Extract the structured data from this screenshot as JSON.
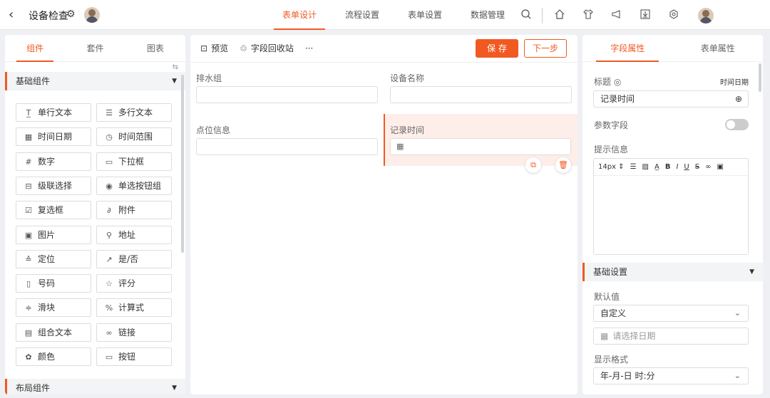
{
  "header": {
    "title": "设备检查",
    "tabs": [
      {
        "label": "表单设计",
        "active": true
      },
      {
        "label": "流程设置",
        "active": false
      },
      {
        "label": "表单设置",
        "active": false
      },
      {
        "label": "数据管理",
        "active": false
      }
    ],
    "icons": [
      "search-icon",
      "home-icon",
      "shirt-icon",
      "megaphone-icon",
      "download-icon",
      "settings-icon"
    ],
    "accent": "#f05a22"
  },
  "left": {
    "tabs": [
      "组件",
      "套件",
      "图表"
    ],
    "section_basic": "基础组件",
    "section_layout": "布局组件",
    "components": [
      {
        "label": "单行文本",
        "icon": "T̲"
      },
      {
        "label": "多行文本",
        "icon": "☰"
      },
      {
        "label": "时间日期",
        "icon": "▦"
      },
      {
        "label": "时间范围",
        "icon": "◷"
      },
      {
        "label": "数字",
        "icon": "#"
      },
      {
        "label": "下拉框",
        "icon": "▭"
      },
      {
        "label": "级联选择",
        "icon": "⊟"
      },
      {
        "label": "单选按钮组",
        "icon": "◉"
      },
      {
        "label": "复选框",
        "icon": "☑"
      },
      {
        "label": "附件",
        "icon": "∂"
      },
      {
        "label": "图片",
        "icon": "▣"
      },
      {
        "label": "地址",
        "icon": "⚲"
      },
      {
        "label": "定位",
        "icon": "≙"
      },
      {
        "label": "是/否",
        "icon": "↗"
      },
      {
        "label": "号码",
        "icon": "▯"
      },
      {
        "label": "评分",
        "icon": "☆"
      },
      {
        "label": "滑块",
        "icon": "≑"
      },
      {
        "label": "计算式",
        "icon": "%"
      },
      {
        "label": "组合文本",
        "icon": "▤"
      },
      {
        "label": "链接",
        "icon": "∞"
      },
      {
        "label": "颜色",
        "icon": "✿"
      },
      {
        "label": "按钮",
        "icon": "▭"
      }
    ]
  },
  "middle": {
    "preview": "预览",
    "recycle": "字段回收站",
    "more": "···",
    "save": "保 存",
    "next": "下一步",
    "fields": {
      "drain_group": "排水组",
      "device_name": "设备名称",
      "point_info": "点位信息",
      "record_time": "记录时间"
    }
  },
  "right": {
    "tabs": [
      "字段属性",
      "表单属性"
    ],
    "title_label": "标题",
    "title_type": "时间日期",
    "title_value": "记录时间",
    "param_label": "参数字段",
    "param_on": false,
    "hint_label": "提示信息",
    "editor_font": "14px ⇕",
    "section_basic": "基础设置",
    "default_label": "默认值",
    "default_value": "自定义",
    "date_placeholder": "请选择日期",
    "format_label": "显示格式",
    "format_value": "年-月-日 时:分"
  }
}
